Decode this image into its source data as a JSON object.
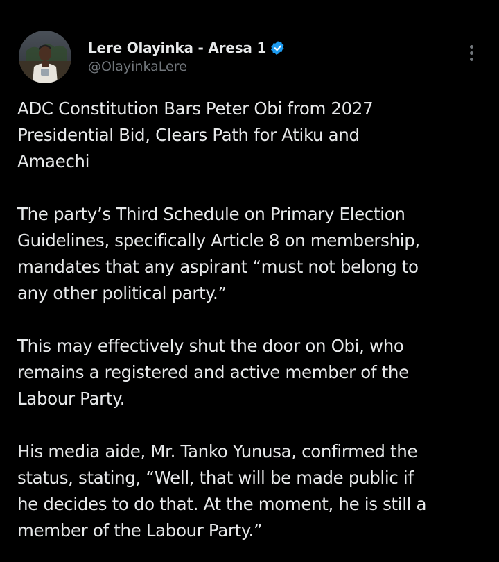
{
  "author": {
    "display_name": "Lere Olayinka - Aresa 1",
    "handle": "@OlayinkaLere",
    "verified": true,
    "avatar_icon": "profile-photo",
    "verified_icon": "verified-badge-icon"
  },
  "menu": {
    "icon": "more-vertical-icon"
  },
  "tweet": {
    "paragraphs": [
      "ADC Constitution Bars Peter Obi from 2027\nPresidential Bid, Clears Path for Atiku and\nAmaechi",
      "The party’s Third Schedule on Primary Election\nGuidelines, specifically Article 8 on membership,\nmandates that any aspirant “must not belong to\nany other political party.”",
      "This may effectively shut the door on Obi, who\nremains a registered and active member of the\nLabour Party.",
      "His media aide, Mr. Tanko Yunusa, confirmed the\nstatus, stating, “Well, that will be made public if\nhe decides to do that. At the moment, he is still a\nmember of the Labour Party.”"
    ]
  },
  "colors": {
    "background": "#000000",
    "text_primary": "#e7e9ea",
    "text_secondary": "#71767b",
    "verified_blue": "#1d9bf0",
    "divider": "#2f3336"
  }
}
